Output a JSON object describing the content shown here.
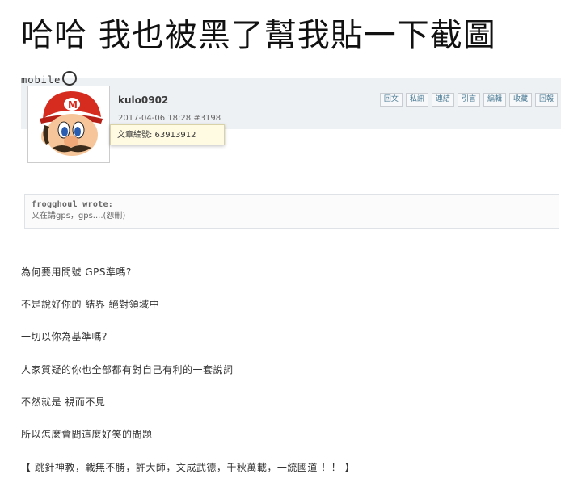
{
  "headline": "哈哈 我也被黑了幫我貼一下截圖",
  "site_badge": "mobile",
  "post": {
    "username": "kulo0902",
    "date": "2017-04-06 18:28",
    "post_number": "#3198",
    "tooltip": "文章編號: 63913912",
    "actions": [
      "回文",
      "私訊",
      "連結",
      "引言",
      "編輯",
      "收藏",
      "回報"
    ]
  },
  "quote": {
    "author": "frogghoul wrote:",
    "text": "又在講gps，gps....(恕刪)"
  },
  "body_lines": [
    "為何要用問號 GPS準嗎?",
    "不是說好你的 結界 絕對領域中",
    "一切以你為基準嗎?",
    "人家質疑的你也全部都有對自己有利的一套說詞",
    "不然就是 視而不見",
    "所以怎麼會問這麼好笑的問題",
    "【 跳針神教，戰無不勝，許大師，文成武德，千秋萬載，一統國道 ！！ 】"
  ],
  "colors": {
    "header_bg": "#eef1f4",
    "tooltip_bg": "#fffbe3",
    "action_text": "#4a7a95",
    "mario_red": "#d62b1f",
    "mario_blue": "#2a5db0"
  },
  "icons": {
    "avatar": "mario-avatar",
    "badge_camera": "camera-icon"
  }
}
